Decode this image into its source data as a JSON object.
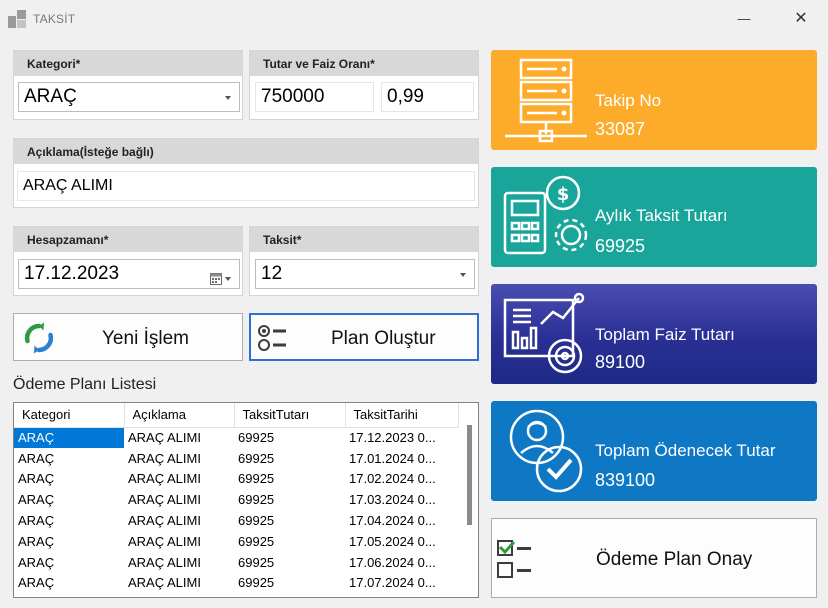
{
  "window": {
    "title": "TAKSİT",
    "minimize_glyph": "—",
    "close_glyph": "✕"
  },
  "kategori": {
    "header": "Kategori*",
    "value": "ARAÇ"
  },
  "tutar": {
    "header": "Tutar ve Faiz Oranı*",
    "amount": "750000",
    "rate": "0,99"
  },
  "aciklama": {
    "header": "Açıklama(İsteğe bağlı)",
    "value": "ARAÇ ALIMI"
  },
  "hesapzamani": {
    "header": "Hesapzamanı*",
    "value": "17.12.2023"
  },
  "taksit": {
    "header": "Taksit*",
    "value": "12"
  },
  "buttons": {
    "new_transaction": "Yeni İşlem",
    "create_plan": "Plan Oluştur",
    "approve_plan": "Ödeme Plan Onay"
  },
  "list": {
    "title": "Ödeme Planı Listesi",
    "columns": [
      "Kategori",
      "Açıklama",
      "TaksitTutarı",
      "TaksitTarihi"
    ],
    "rows": [
      [
        "ARAÇ",
        "ARAÇ ALIMI",
        "69925",
        "17.12.2023 0..."
      ],
      [
        "ARAÇ",
        "ARAÇ ALIMI",
        "69925",
        "17.01.2024 0..."
      ],
      [
        "ARAÇ",
        "ARAÇ ALIMI",
        "69925",
        "17.02.2024 0..."
      ],
      [
        "ARAÇ",
        "ARAÇ ALIMI",
        "69925",
        "17.03.2024 0..."
      ],
      [
        "ARAÇ",
        "ARAÇ ALIMI",
        "69925",
        "17.04.2024 0..."
      ],
      [
        "ARAÇ",
        "ARAÇ ALIMI",
        "69925",
        "17.05.2024 0..."
      ],
      [
        "ARAÇ",
        "ARAÇ ALIMI",
        "69925",
        "17.06.2024 0..."
      ],
      [
        "ARAÇ",
        "ARAÇ ALIMI",
        "69925",
        "17.07.2024 0..."
      ]
    ]
  },
  "tiles": {
    "takip": {
      "label": "Takip No",
      "value": "33087",
      "icon": "server-icon",
      "color": "#fdab2a"
    },
    "aylik": {
      "label": "Aylık Taksit Tutarı",
      "value": "69925",
      "icon": "calculator-money-icon",
      "color": "#1aa59b"
    },
    "faiz": {
      "label": "Toplam Faiz Tutarı",
      "value": "89100",
      "icon": "analytics-board-icon",
      "color": "#2d3a9e"
    },
    "odenecek": {
      "label": "Toplam Ödenecek Tutar",
      "value": "839100",
      "icon": "user-check-icon",
      "color": "#0e78c5"
    }
  }
}
